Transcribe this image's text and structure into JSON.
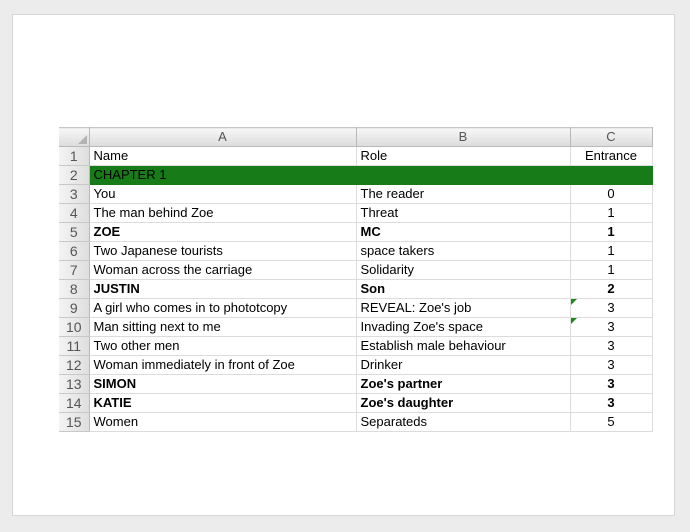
{
  "sheet": {
    "columns": [
      "A",
      "B",
      "C"
    ],
    "rows": [
      {
        "n": "1",
        "a": "Name",
        "b": "Role",
        "c": "Entrance",
        "bold": false,
        "green": false,
        "tri": false
      },
      {
        "n": "2",
        "a": "CHAPTER 1",
        "b": "",
        "c": "",
        "bold": false,
        "green": true,
        "tri": false
      },
      {
        "n": "3",
        "a": "You",
        "b": "The reader",
        "c": "0",
        "bold": false,
        "green": false,
        "tri": false
      },
      {
        "n": "4",
        "a": "The man behind Zoe",
        "b": "Threat",
        "c": "1",
        "bold": false,
        "green": false,
        "tri": false
      },
      {
        "n": "5",
        "a": "ZOE",
        "b": "MC",
        "c": "1",
        "bold": true,
        "green": false,
        "tri": false
      },
      {
        "n": "6",
        "a": "Two Japanese tourists",
        "b": "space takers",
        "c": "1",
        "bold": false,
        "green": false,
        "tri": false
      },
      {
        "n": "7",
        "a": "Woman across the carriage",
        "b": "Solidarity",
        "c": "1",
        "bold": false,
        "green": false,
        "tri": false
      },
      {
        "n": "8",
        "a": "JUSTIN",
        "b": "Son",
        "c": "2",
        "bold": true,
        "green": false,
        "tri": false
      },
      {
        "n": "9",
        "a": "A girl who comes in to phototcopy",
        "b": "REVEAL: Zoe's job",
        "c": "3",
        "bold": false,
        "green": false,
        "tri": true
      },
      {
        "n": "10",
        "a": "Man sitting next to me",
        "b": "Invading Zoe's space",
        "c": "3",
        "bold": false,
        "green": false,
        "tri": true
      },
      {
        "n": "11",
        "a": "Two other men",
        "b": "Establish male behaviour",
        "c": "3",
        "bold": false,
        "green": false,
        "tri": false
      },
      {
        "n": "12",
        "a": "Woman immediately in front of Zoe",
        "b": "Drinker",
        "c": "3",
        "bold": false,
        "green": false,
        "tri": false
      },
      {
        "n": "13",
        "a": "SIMON",
        "b": "Zoe's partner",
        "c": "3",
        "bold": true,
        "green": false,
        "tri": false
      },
      {
        "n": "14",
        "a": "KATIE",
        "b": "Zoe's daughter",
        "c": "3",
        "bold": true,
        "green": false,
        "tri": false
      },
      {
        "n": "15",
        "a": "Women",
        "b": "Separateds",
        "c": "5",
        "bold": false,
        "green": false,
        "tri": false
      }
    ]
  },
  "colors": {
    "chapter_fill": "#177b17",
    "comment_marker": "#1e8a1e"
  }
}
